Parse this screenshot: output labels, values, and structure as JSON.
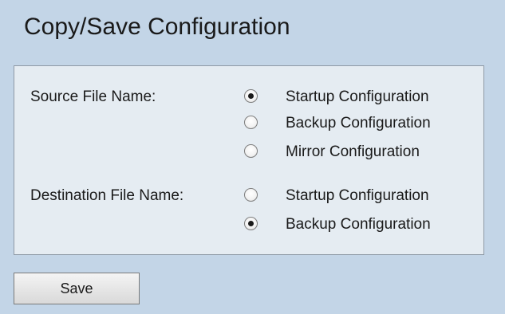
{
  "page": {
    "title": "Copy/Save Configuration"
  },
  "source": {
    "label": "Source File Name:",
    "options": [
      {
        "label": "Startup Configuration",
        "checked": true
      },
      {
        "label": "Backup Configuration",
        "checked": false
      },
      {
        "label": "Mirror Configuration",
        "checked": false
      }
    ]
  },
  "destination": {
    "label": "Destination File Name:",
    "options": [
      {
        "label": "Startup Configuration",
        "checked": false
      },
      {
        "label": "Backup Configuration",
        "checked": true
      }
    ]
  },
  "actions": {
    "save_label": "Save"
  },
  "colors": {
    "background": "#c3d5e7",
    "panel": "#e5ecf2",
    "panel_border": "#8e9aa6"
  }
}
